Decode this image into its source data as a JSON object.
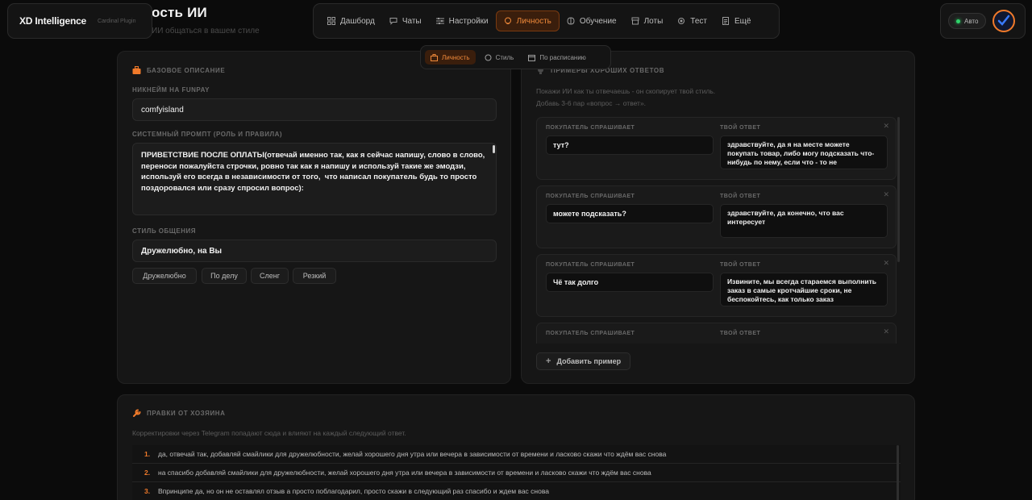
{
  "brand": {
    "name": "XD Intelligence",
    "sub": "Cardinal Plugin"
  },
  "page": {
    "title": "ость ИИ",
    "subtitle": "ИИ общаться в вашем стиле"
  },
  "nav": {
    "items": [
      {
        "label": "Дашборд",
        "icon": "grid-icon"
      },
      {
        "label": "Чаты",
        "icon": "chat-icon"
      },
      {
        "label": "Настройки",
        "icon": "sliders-icon"
      },
      {
        "label": "Личность",
        "icon": "persona-icon",
        "active": true
      },
      {
        "label": "Обучение",
        "icon": "brain-icon"
      },
      {
        "label": "Лоты",
        "icon": "box-icon"
      },
      {
        "label": "Тест",
        "icon": "chip-icon"
      },
      {
        "label": "Ещё",
        "icon": "file-icon"
      }
    ]
  },
  "status": {
    "auto_label": "Авто"
  },
  "subtabs": [
    {
      "label": "Личность",
      "active": true
    },
    {
      "label": "Стиль"
    },
    {
      "label": "По расписанию"
    }
  ],
  "base": {
    "title": "Базовое описание",
    "nickname_label": "Никнейм на FunPay",
    "nickname_value": "comfyisland",
    "prompt_label": "Системный промпт (роль и правила)",
    "prompt_value": "ПРИВЕТСТВИЕ ПОСЛЕ ОПЛАТЫ(отвечай именно так, как я сейчас напишу, слово в слово, переноси пожалуйста строчки, ровно так как я напишу и используй такие же эмодзи, используй его всегда в независимости от того,  что написал покупатель будь то просто поздоровался или сразу спросил вопрос):\n\n\nЯ умный бот-помощник продавца — сам отвечаю на вопросы по лоту, помогаю",
    "style_label": "Стиль общения",
    "style_value": "Дружелюбно, на Вы",
    "style_chips": [
      "Дружелюбно",
      "По делу",
      "Сленг",
      "Резкий"
    ]
  },
  "examples": {
    "title": "Примеры хороших ответов",
    "hint_line1": "Покажи ИИ как ты отвечаешь - он скопирует твой стиль.",
    "hint_line2": "Добавь 3-6 пар «вопрос → ответ».",
    "q_label": "Покупатель спрашивает",
    "a_label": "Твой ответ",
    "items": [
      {
        "q": "тут?",
        "a": "здравствуйте, да я на месте можете покупать товар, либо могу подсказать что-нибудь по нему, если что - то не"
      },
      {
        "q": "можете подсказать?",
        "a": "здравствуйте, да конечно, что вас интересует"
      },
      {
        "q": "Чё так долго",
        "a": "Извините, мы всегда стараемся выполнить заказ в самые кротчайшие сроки, не беспокойтесь, как только заказ"
      },
      {
        "q": "",
        "a": ""
      }
    ],
    "add_label": "Добавить пример"
  },
  "corrections": {
    "title": "Правки от хозяина",
    "hint": "Корректировки через Telegram попадают сюда и влияют на каждый следующий ответ.",
    "items": [
      {
        "num": "1.",
        "text": "да, отвечай так, добавляй смайлики для дружелюбности, желай хорошего дня утра или вечера в зависимости от времени и ласково скажи что ждём вас снова"
      },
      {
        "num": "2.",
        "text": "на спасибо добавляй смайлики для дружелюбности, желай хорошего дня утра или вечера в зависимости от времени и ласково скажи что ждём вас снова"
      },
      {
        "num": "3.",
        "text": "Впринципе да, но он не оставлял отзыв а просто поблагодарил, просто скажи в следующий раз спасибо и ждем вас снова"
      }
    ]
  },
  "colors": {
    "accent": "#f07a2a",
    "background": "#0b0b0b",
    "panel": "#161616",
    "online": "#2fd36a"
  }
}
